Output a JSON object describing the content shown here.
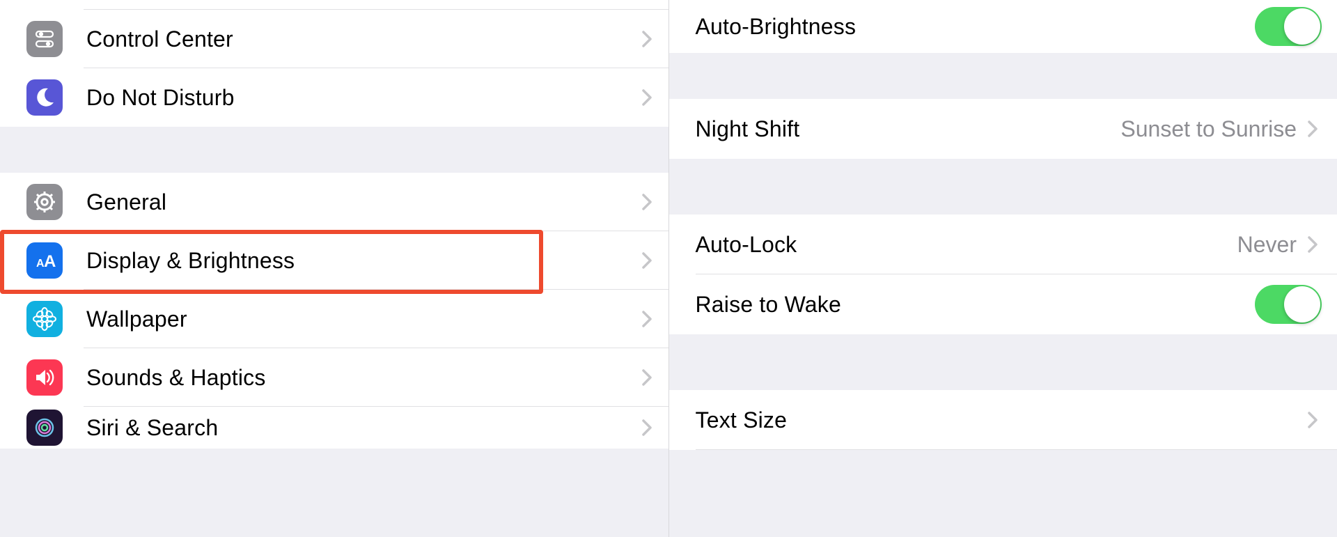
{
  "left": {
    "group1": [
      {
        "id": "control-center",
        "label": "Control Center",
        "icon": "toggles-icon",
        "icon_bg": "#8e8e93"
      },
      {
        "id": "do-not-disturb",
        "label": "Do Not Disturb",
        "icon": "moon-icon",
        "icon_bg": "#5856d6"
      }
    ],
    "group2": [
      {
        "id": "general",
        "label": "General",
        "icon": "gear-icon",
        "icon_bg": "#8e8e93"
      },
      {
        "id": "display-brightness",
        "label": "Display & Brightness",
        "icon": "text-size-icon",
        "icon_bg": "#1471ed",
        "highlighted": true
      },
      {
        "id": "wallpaper",
        "label": "Wallpaper",
        "icon": "flower-icon",
        "icon_bg": "#11b0e0"
      },
      {
        "id": "sounds-haptics",
        "label": "Sounds & Haptics",
        "icon": "speaker-icon",
        "icon_bg": "#fc3753"
      },
      {
        "id": "siri-search",
        "label": "Siri & Search",
        "icon": "siri-icon",
        "icon_bg": "#1f1433"
      }
    ]
  },
  "right": {
    "autoBrightness": {
      "label": "Auto-Brightness",
      "on": true
    },
    "nightShift": {
      "label": "Night Shift",
      "value": "Sunset to Sunrise"
    },
    "autoLock": {
      "label": "Auto-Lock",
      "value": "Never"
    },
    "raiseToWake": {
      "label": "Raise to Wake",
      "on": true
    },
    "textSize": {
      "label": "Text Size"
    }
  },
  "colors": {
    "toggle_on": "#4cd964",
    "highlight": "#ee4a2e"
  }
}
